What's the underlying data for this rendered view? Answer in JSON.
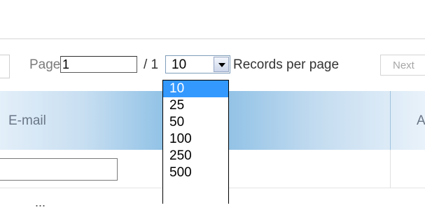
{
  "pager": {
    "page_label": "Page",
    "page_value": "1",
    "total_label": "/ 1",
    "records_per_page": "10",
    "records_per_page_label": "Records per page",
    "next_label": "Next"
  },
  "grid": {
    "header_email": "E-mail",
    "header_next_col": "A",
    "below_text": "..."
  },
  "dropdown": {
    "options": [
      "10",
      "25",
      "50",
      "100",
      "250",
      "500"
    ],
    "selected": "10"
  },
  "colors": {
    "selection": "#3399ff",
    "header_gradient_mid": "#7eb8e2"
  }
}
